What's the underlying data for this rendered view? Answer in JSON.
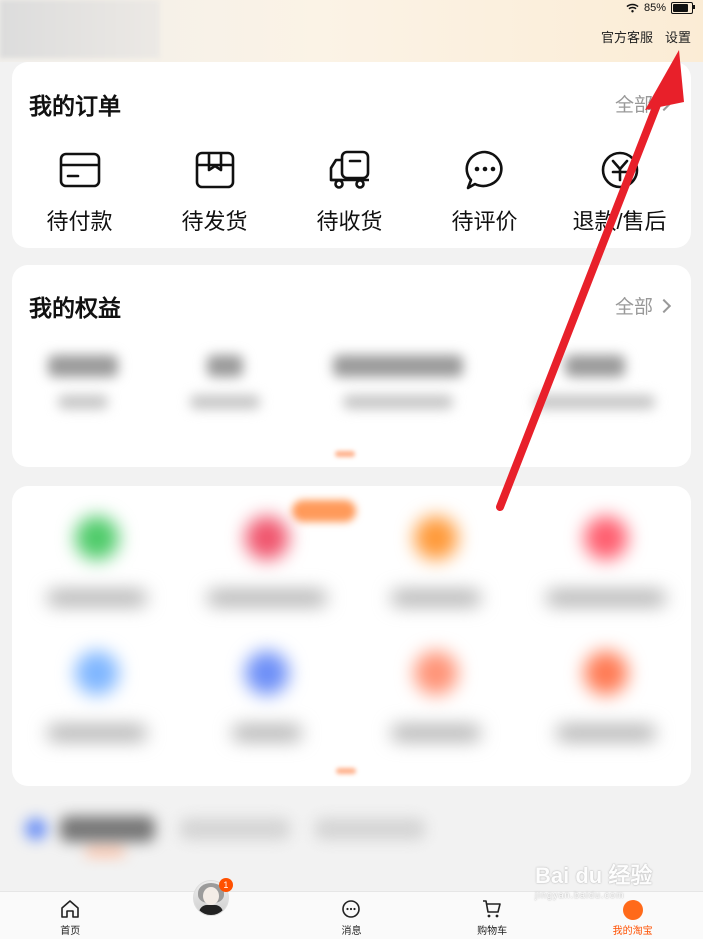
{
  "status": {
    "battery": "85%"
  },
  "header": {
    "customer_service": "官方客服",
    "settings": "设置"
  },
  "orders": {
    "title": "我的订单",
    "more": "全部",
    "items": [
      {
        "label": "待付款",
        "icon": "wallet-icon"
      },
      {
        "label": "待发货",
        "icon": "box-icon"
      },
      {
        "label": "待收货",
        "icon": "truck-icon"
      },
      {
        "label": "待评价",
        "icon": "chat-bubble-icon"
      },
      {
        "label": "退款/售后",
        "icon": "refund-icon"
      }
    ]
  },
  "benefits": {
    "title": "我的权益",
    "more": "全部"
  },
  "tabbar": {
    "items": [
      {
        "label": "首页",
        "icon": "home-icon"
      },
      {
        "label": "",
        "icon": "avatar-icon",
        "badge": "1"
      },
      {
        "label": "消息",
        "icon": "message-icon"
      },
      {
        "label": "购物车",
        "icon": "cart-icon"
      },
      {
        "label": "我的淘宝",
        "icon": "profile-icon"
      }
    ]
  },
  "watermark": {
    "text": "Bai du 经验",
    "sub": "jingyan.baidu.com"
  },
  "colors": {
    "accent": "#ff5000",
    "arrow": "#e8202a"
  }
}
